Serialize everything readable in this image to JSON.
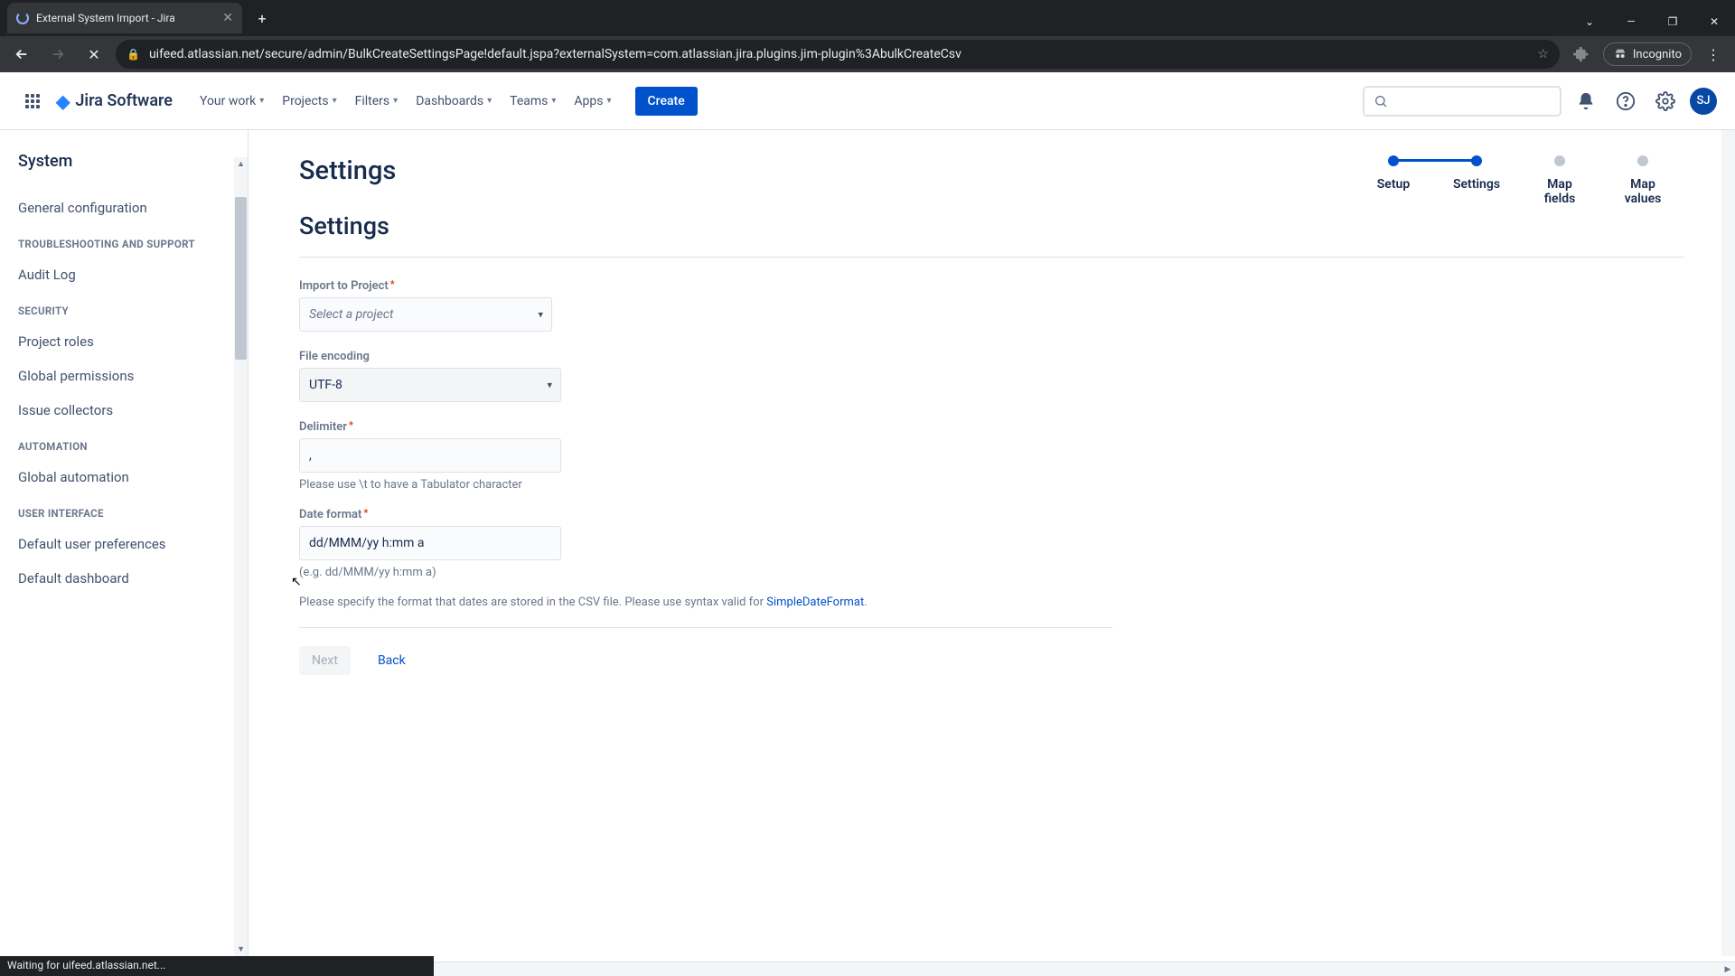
{
  "browser": {
    "tab_title": "External System Import - Jira",
    "url": "uifeed.atlassian.net/secure/admin/BulkCreateSettingsPage!default.jspa?externalSystem=com.atlassian.jira.plugins.jim-plugin%3AbulkCreateCsv",
    "incognito": "Incognito",
    "status": "Waiting for uifeed.atlassian.net..."
  },
  "header": {
    "product": "Jira Software",
    "nav": [
      "Your work",
      "Projects",
      "Filters",
      "Dashboards",
      "Teams",
      "Apps"
    ],
    "create": "Create",
    "avatar": "SJ"
  },
  "sidebar": {
    "title": "System",
    "groups": [
      {
        "heading": null,
        "items": [
          "General configuration"
        ]
      },
      {
        "heading": "TROUBLESHOOTING AND SUPPORT",
        "items": [
          "Audit Log"
        ]
      },
      {
        "heading": "SECURITY",
        "items": [
          "Project roles",
          "Global permissions",
          "Issue collectors"
        ]
      },
      {
        "heading": "AUTOMATION",
        "items": [
          "Global automation"
        ]
      },
      {
        "heading": "USER INTERFACE",
        "items": [
          "Default user preferences",
          "Default dashboard"
        ]
      }
    ]
  },
  "wizard": {
    "steps": [
      "Setup",
      "Settings",
      "Map fields",
      "Map values"
    ],
    "active_index": 1
  },
  "page": {
    "title": "Settings",
    "section_title": "Settings"
  },
  "form": {
    "import_project": {
      "label": "Import to Project",
      "placeholder": "Select a project"
    },
    "file_encoding": {
      "label": "File encoding",
      "value": "UTF-8"
    },
    "delimiter": {
      "label": "Delimiter",
      "value": ",",
      "help": "Please use \\t to have a Tabulator character"
    },
    "date_format": {
      "label": "Date format",
      "value": "dd/MMM/yy h:mm a",
      "example": "(e.g. dd/MMM/yy h:mm a)",
      "help_pre": "Please specify the format that dates are stored in the CSV file. Please use syntax valid for ",
      "help_link": "SimpleDateFormat",
      "help_post": "."
    },
    "buttons": {
      "next": "Next",
      "back": "Back"
    }
  }
}
